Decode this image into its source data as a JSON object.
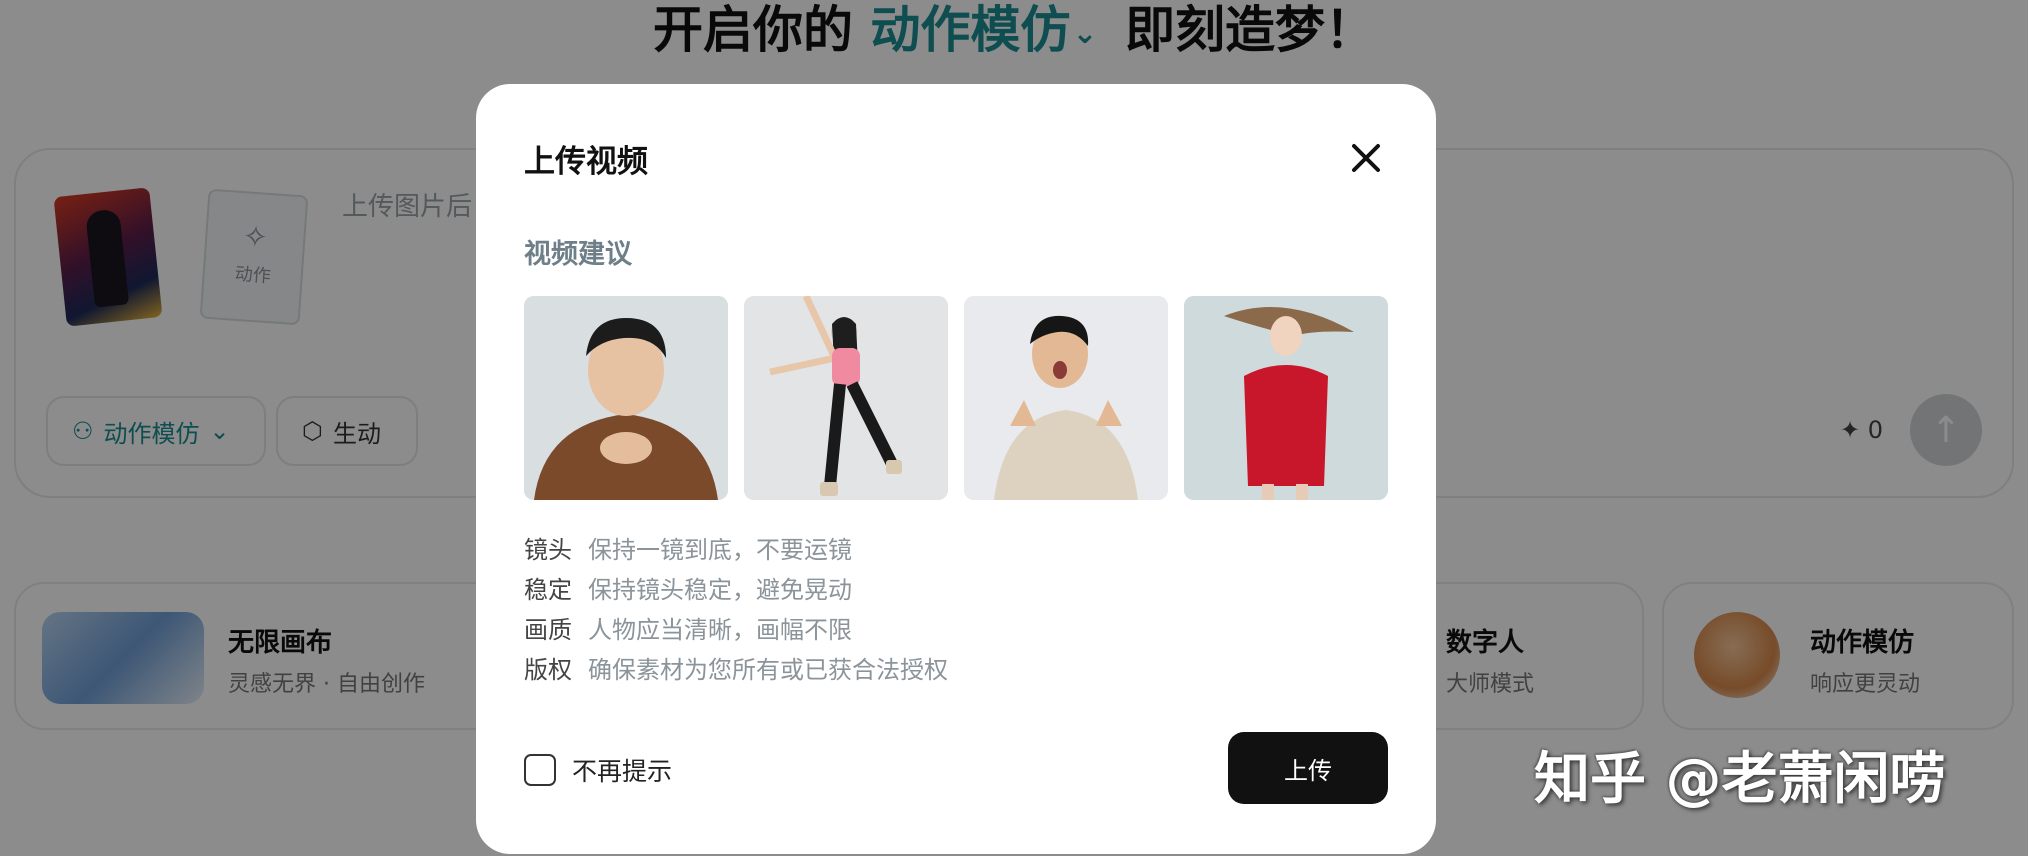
{
  "background": {
    "headline": {
      "before": "开启你的",
      "accent": "动作模仿",
      "after": "即刻造梦！",
      "dropdown_icon": "chevron-down-icon"
    },
    "prompt_card": {
      "action_thumb_label": "动作",
      "placeholder": "上传图片后",
      "chips": {
        "mode_label": "动作模仿",
        "vivid_label": "生动"
      },
      "credits": "0"
    },
    "features": [
      {
        "title": "无限画布",
        "subtitle": "灵感无界 · 自由创作"
      },
      {
        "title": "数字人",
        "subtitle": "大师模式"
      },
      {
        "title": "动作模仿",
        "subtitle": "响应更灵动"
      }
    ]
  },
  "modal": {
    "title": "上传视频",
    "section_title": "视频建议",
    "tips": [
      {
        "key": "镜头",
        "value": "保持一镜到底，不要运镜"
      },
      {
        "key": "稳定",
        "value": "保持镜头稳定，避免晃动"
      },
      {
        "key": "画质",
        "value": "人物应当清晰，画幅不限"
      },
      {
        "key": "版权",
        "value": "确保素材为您所有或已获合法授权"
      }
    ],
    "dont_show_label": "不再提示",
    "dont_show_checked": false,
    "upload_label": "上传"
  },
  "watermark": "知乎 @老萧闲唠",
  "colors": {
    "accent": "#1a8c92",
    "overlay": "rgba(0,0,0,0.45)",
    "primary_button": "#111111"
  }
}
